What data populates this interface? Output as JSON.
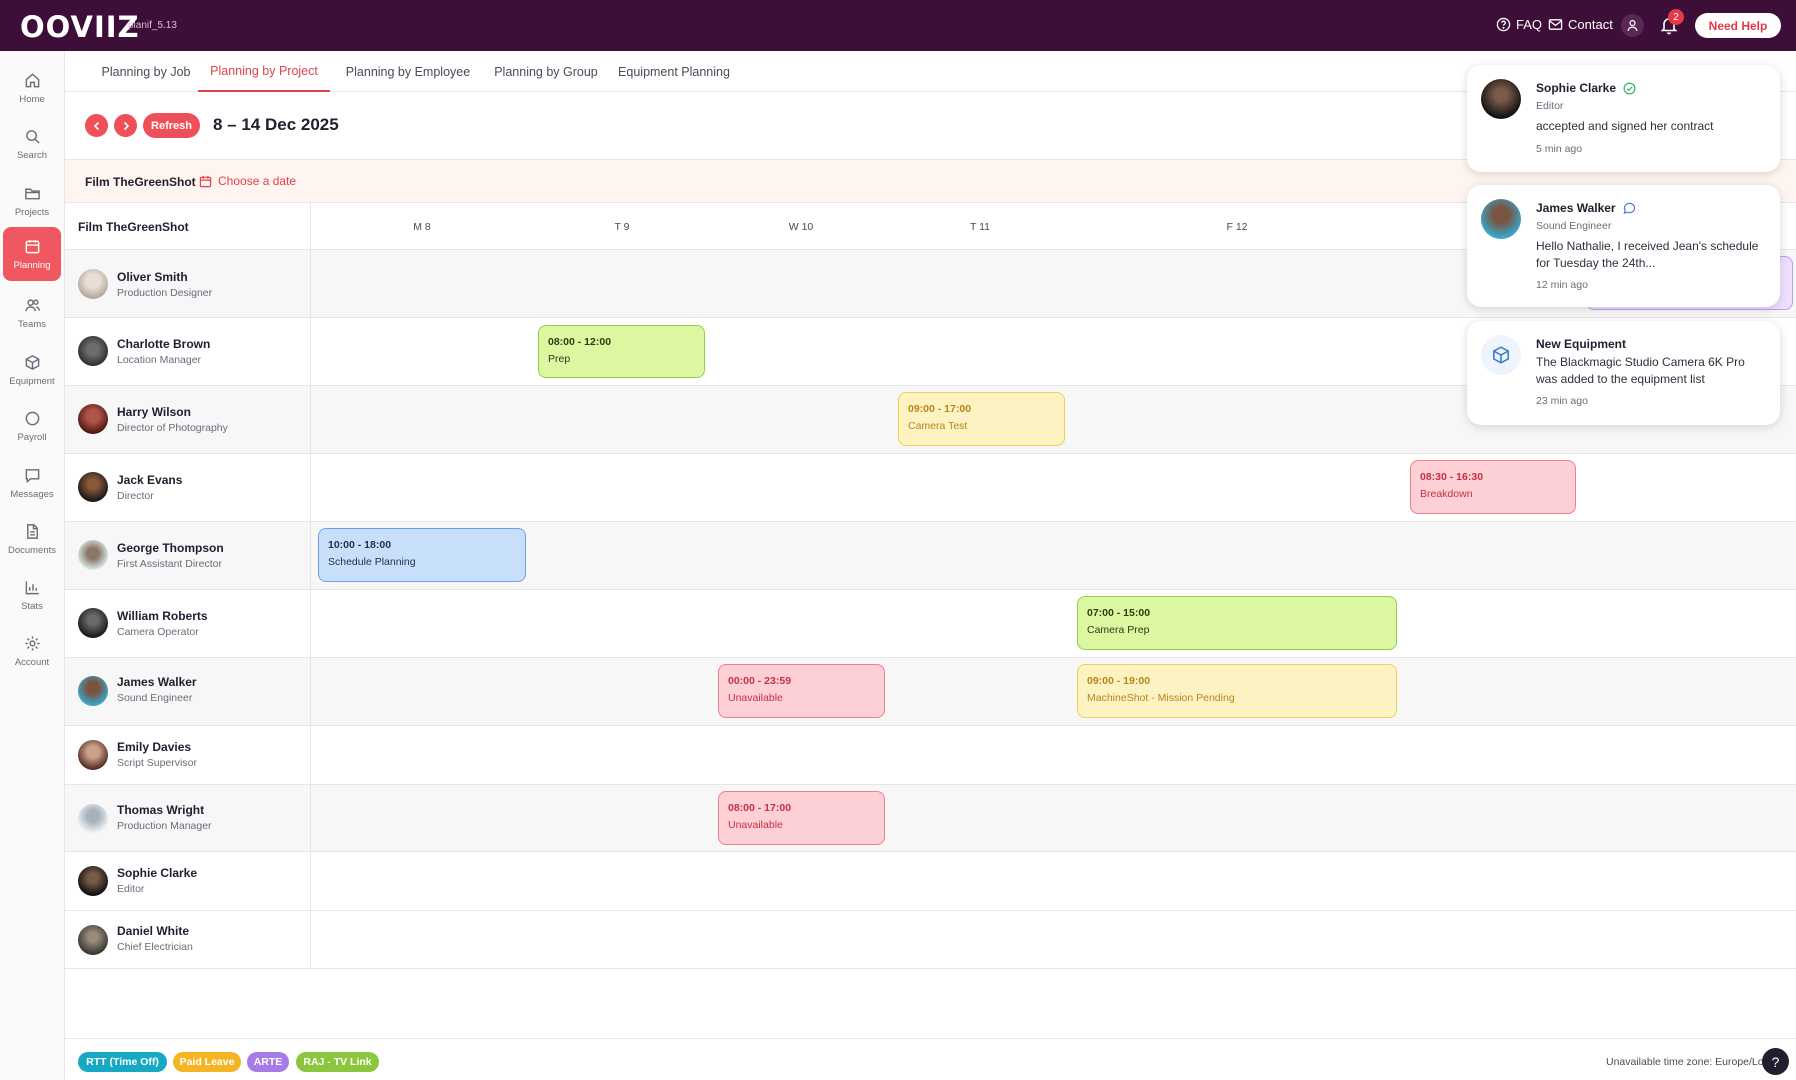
{
  "app": {
    "logo": "OOVIIZ",
    "version": "planif_5.13"
  },
  "topbar": {
    "faq": "FAQ",
    "contact": "Contact",
    "notif_count": "2",
    "need_help": "Need Help"
  },
  "sidebar": {
    "items": [
      {
        "label": "Home",
        "icon": "home-icon"
      },
      {
        "label": "Search",
        "icon": "search-icon"
      },
      {
        "label": "Projects",
        "icon": "folder-icon"
      },
      {
        "label": "Planning",
        "icon": "calendar-icon",
        "active": true
      },
      {
        "label": "Teams",
        "icon": "users-icon"
      },
      {
        "label": "Equipment",
        "icon": "box-icon"
      },
      {
        "label": "Payroll",
        "icon": "circle-icon"
      },
      {
        "label": "Messages",
        "icon": "message-icon"
      },
      {
        "label": "Documents",
        "icon": "document-icon"
      },
      {
        "label": "Stats",
        "icon": "chart-icon"
      },
      {
        "label": "Account",
        "icon": "gear-icon"
      }
    ]
  },
  "tabs": [
    "Planning by Job",
    "Planning by Project",
    "Planning by Employee",
    "Planning by Group",
    "Equipment Planning"
  ],
  "toolbar": {
    "refresh": "Refresh",
    "date_range": "8 – 14 Dec 2025"
  },
  "project_bar": {
    "name": "Film TheGreenShot",
    "choose_date": "Choose a date"
  },
  "grid": {
    "title": "Film TheGreenShot",
    "days": [
      "M 8",
      "T 9",
      "W 10",
      "T 11",
      "F 12"
    ]
  },
  "employees": [
    {
      "name": "Oliver Smith",
      "role": "Production Designer"
    },
    {
      "name": "Charlotte Brown",
      "role": "Location Manager"
    },
    {
      "name": "Harry Wilson",
      "role": "Director of Photography"
    },
    {
      "name": "Jack Evans",
      "role": "Director"
    },
    {
      "name": "George Thompson",
      "role": "First Assistant Director"
    },
    {
      "name": "William Roberts",
      "role": "Camera Operator"
    },
    {
      "name": "James Walker",
      "role": "Sound Engineer"
    },
    {
      "name": "Emily Davies",
      "role": "Script Supervisor"
    },
    {
      "name": "Thomas Wright",
      "role": "Production Manager"
    },
    {
      "name": "Sophie Clarke",
      "role": "Editor"
    },
    {
      "name": "Daniel White",
      "role": "Chief Electrician"
    }
  ],
  "events": [
    {
      "time": "08:00 - 12:00",
      "label": "Prep",
      "color": "green"
    },
    {
      "time": "09:00 - 17:00",
      "label": "Camera Test",
      "color": "yellow"
    },
    {
      "time": "08:30 - 16:30",
      "label": "Breakdown",
      "color": "pink"
    },
    {
      "time": "10:00 - 18:00",
      "label": "Schedule Planning",
      "color": "blue"
    },
    {
      "time": "07:00 - 15:00",
      "label": "Camera Prep",
      "color": "green"
    },
    {
      "time": "00:00 - 23:59",
      "label": "Unavailable",
      "color": "pink"
    },
    {
      "time": "09:00 - 19:00",
      "label": "MachineShot - Mission Pending",
      "color": "yellow"
    },
    {
      "time": "08:00 - 17:00",
      "label": "Unavailable",
      "color": "pink"
    }
  ],
  "legend": [
    {
      "label": "RTT (Time Off)",
      "color": "#17a9c4"
    },
    {
      "label": "Paid Leave",
      "color": "#f5b423"
    },
    {
      "label": "ARTE",
      "color": "#a77be6"
    },
    {
      "label": "RAJ - TV Link",
      "color": "#8cc63f"
    }
  ],
  "timezone": "Unavailable time zone: Europe/London",
  "notifications": [
    {
      "name": "Sophie Clarke",
      "subtitle": "Editor",
      "body": "accepted and signed her contract",
      "time": "5 min ago",
      "icon": "check-circle-icon"
    },
    {
      "name": "James Walker",
      "subtitle": "Sound Engineer",
      "body": "Hello Nathalie, I received Jean's schedule for Tuesday the 24th...",
      "time": "12 min ago",
      "icon": "chat-bubble-icon"
    },
    {
      "name": "New Equipment",
      "subtitle": "",
      "body": "The Blackmagic Studio Camera 6K Pro was added to the equipment list",
      "time": "23 min ago",
      "icon": "package-icon"
    }
  ]
}
